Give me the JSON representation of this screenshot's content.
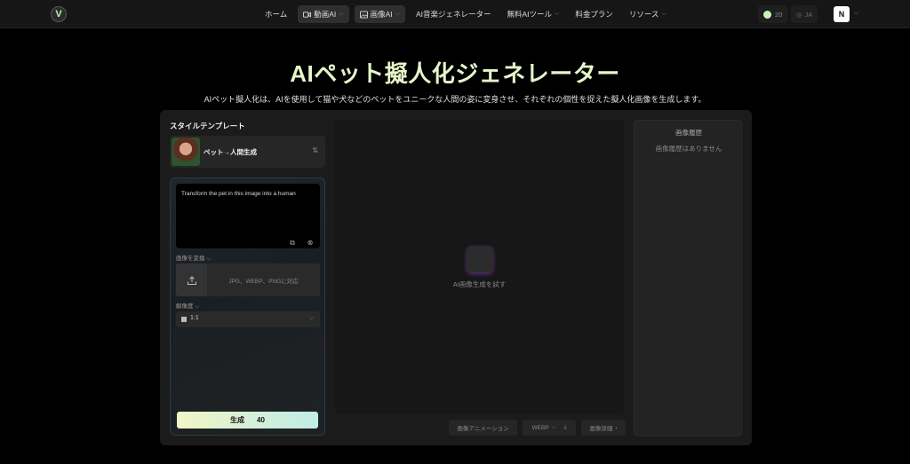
{
  "nav": {
    "logo": "V",
    "links": [
      {
        "label": "ホーム",
        "active": false,
        "dropdown": false,
        "icon": ""
      },
      {
        "label": "動画AI",
        "active": true,
        "dropdown": true,
        "icon": "video-icon"
      },
      {
        "label": "画像AI",
        "active": true,
        "dropdown": true,
        "icon": "image-icon"
      },
      {
        "label": "AI音楽ジェネレーター",
        "active": false,
        "dropdown": false,
        "icon": ""
      },
      {
        "label": "無料AIツール",
        "active": false,
        "dropdown": true,
        "icon": ""
      },
      {
        "label": "料金プラン",
        "active": false,
        "dropdown": false,
        "icon": ""
      },
      {
        "label": "リソース",
        "active": false,
        "dropdown": true,
        "icon": ""
      }
    ],
    "credits": "20",
    "language": "JA",
    "avatar": "N"
  },
  "hero": {
    "title": "AIペット擬人化ジェネレーター",
    "subtitle": "AIペット擬人化は、AIを使用して猫や犬などのペットをユニークな人間の姿に変身させ、それぞれの個性を捉えた擬人化画像を生成します。"
  },
  "left": {
    "section_title": "スタイルテンプレート",
    "template_label": "ペット→人間生成",
    "prompt": "Transform the pet in this image into a human",
    "upload_label": "画像を変換",
    "upload_hint": "JPG、WEBP、PNGに対応",
    "resolution_label": "解像度",
    "ratio": "1:1",
    "generate_label": "生成",
    "generate_cost": "40"
  },
  "canvas": {
    "placeholder": "AI画像生成を試す",
    "animate_label": "画像アニメーション",
    "format_label": "WEBP",
    "details_label": "画像詳細"
  },
  "history": {
    "title": "画像履歴",
    "empty": "画像履歴はありません"
  }
}
